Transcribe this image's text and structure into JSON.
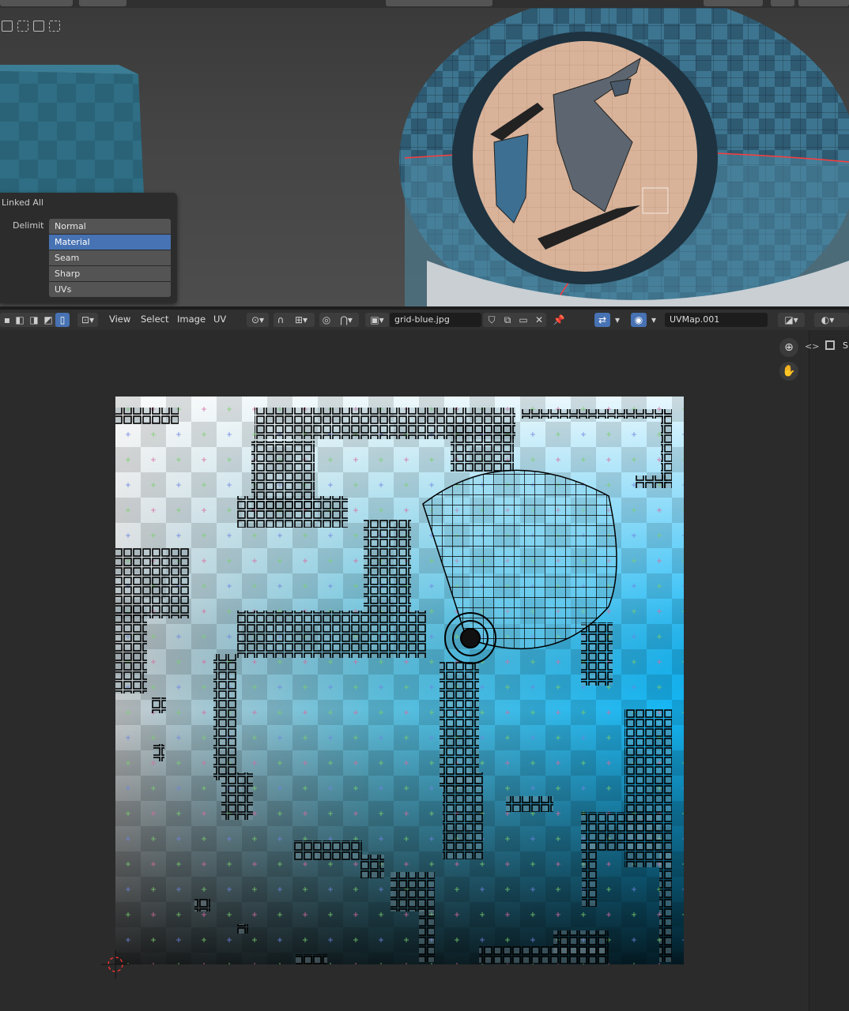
{
  "uv_header": {
    "menus": [
      "View",
      "Select",
      "Image",
      "UV"
    ],
    "image_name": "grid-blue.jpg",
    "uv_map": "UVMap.001"
  },
  "redo_panel": {
    "title": "Linked All",
    "delimit_label": "Delimit",
    "options": [
      "Normal",
      "Material",
      "Seam",
      "Sharp",
      "UVs"
    ],
    "selected": "Material"
  },
  "sidebar": {
    "tab_label": "Si"
  },
  "colors": {
    "accent": "#4772b3",
    "header_bg": "#303030",
    "panel_bg": "#2c2c2c"
  }
}
